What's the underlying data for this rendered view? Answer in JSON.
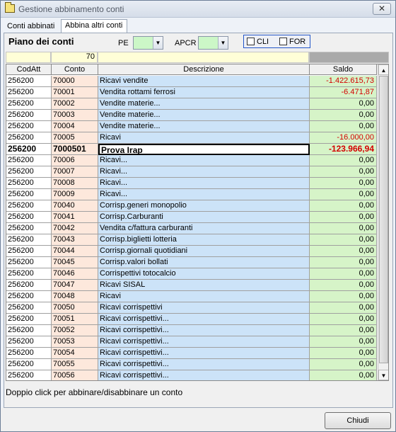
{
  "window": {
    "title": "Gestione abbinamento conti",
    "close_label": "✕"
  },
  "tabs": [
    {
      "label": "Conti abbinati"
    },
    {
      "label": "Abbina altri conti"
    }
  ],
  "toolbar": {
    "heading": "Piano dei conti",
    "pe_label": "PE",
    "apcr_label": "APCR",
    "cli_label": "CLI",
    "for_label": "FOR"
  },
  "filter": {
    "conto": "70"
  },
  "table": {
    "headers": [
      "CodAtt",
      "Conto",
      "Descrizione",
      "Saldo"
    ],
    "rows": [
      {
        "cod": "256200",
        "conto": "70000",
        "desc": "Ricavi vendite",
        "saldo": "-1.422.615,73",
        "neg": true
      },
      {
        "cod": "256200",
        "conto": "70001",
        "desc": "Vendita rottami ferrosi",
        "saldo": "-6.471,87",
        "neg": true
      },
      {
        "cod": "256200",
        "conto": "70002",
        "desc": "Vendite materie...",
        "saldo": "0,00"
      },
      {
        "cod": "256200",
        "conto": "70003",
        "desc": "Vendite materie...",
        "saldo": "0,00"
      },
      {
        "cod": "256200",
        "conto": "70004",
        "desc": "Vendite materie...",
        "saldo": "0,00"
      },
      {
        "cod": "256200",
        "conto": "70005",
        "desc": "Ricavi",
        "saldo": "-16.000,00",
        "neg": true
      },
      {
        "cod": "256200",
        "conto": "7000501",
        "desc": "Prova Irap",
        "saldo": "-123.966,94",
        "neg": true,
        "selected": true
      },
      {
        "cod": "256200",
        "conto": "70006",
        "desc": "Ricavi...",
        "saldo": "0,00"
      },
      {
        "cod": "256200",
        "conto": "70007",
        "desc": "Ricavi...",
        "saldo": "0,00"
      },
      {
        "cod": "256200",
        "conto": "70008",
        "desc": "Ricavi...",
        "saldo": "0,00"
      },
      {
        "cod": "256200",
        "conto": "70009",
        "desc": "Ricavi...",
        "saldo": "0,00"
      },
      {
        "cod": "256200",
        "conto": "70040",
        "desc": "Corrisp.generi monopolio",
        "saldo": "0,00"
      },
      {
        "cod": "256200",
        "conto": "70041",
        "desc": "Corrisp.Carburanti",
        "saldo": "0,00"
      },
      {
        "cod": "256200",
        "conto": "70042",
        "desc": "Vendita c/fattura carburanti",
        "saldo": "0,00"
      },
      {
        "cod": "256200",
        "conto": "70043",
        "desc": "Corrisp.biglietti lotteria",
        "saldo": "0,00"
      },
      {
        "cod": "256200",
        "conto": "70044",
        "desc": "Corrisp.giornali quotidiani",
        "saldo": "0,00"
      },
      {
        "cod": "256200",
        "conto": "70045",
        "desc": "Corrisp.valori bollati",
        "saldo": "0,00"
      },
      {
        "cod": "256200",
        "conto": "70046",
        "desc": "Corrispettivi totocalcio",
        "saldo": "0,00"
      },
      {
        "cod": "256200",
        "conto": "70047",
        "desc": "Ricavi SISAL",
        "saldo": "0,00"
      },
      {
        "cod": "256200",
        "conto": "70048",
        "desc": "Ricavi",
        "saldo": "0,00"
      },
      {
        "cod": "256200",
        "conto": "70050",
        "desc": "Ricavi corrispettivi",
        "saldo": "0,00"
      },
      {
        "cod": "256200",
        "conto": "70051",
        "desc": "Ricavi corrispettivi...",
        "saldo": "0,00"
      },
      {
        "cod": "256200",
        "conto": "70052",
        "desc": "Ricavi corrispettivi...",
        "saldo": "0,00"
      },
      {
        "cod": "256200",
        "conto": "70053",
        "desc": "Ricavi corrispettivi...",
        "saldo": "0,00"
      },
      {
        "cod": "256200",
        "conto": "70054",
        "desc": "Ricavi corrispettivi...",
        "saldo": "0,00"
      },
      {
        "cod": "256200",
        "conto": "70055",
        "desc": "Ricavi corrispettivi...",
        "saldo": "0,00"
      },
      {
        "cod": "256200",
        "conto": "70056",
        "desc": "Ricavi corrispettivi...",
        "saldo": "0,00"
      }
    ]
  },
  "hint": "Doppio click per abbinare/disabbinare un conto",
  "footer": {
    "close_button": "Chiudi"
  },
  "colors": {
    "negative": "#d40000",
    "conto_bg": "#fde8dc",
    "desc_bg": "#cce3f8",
    "saldo_bg": "#d6f4c8",
    "filter_bg": "#fffed7"
  }
}
